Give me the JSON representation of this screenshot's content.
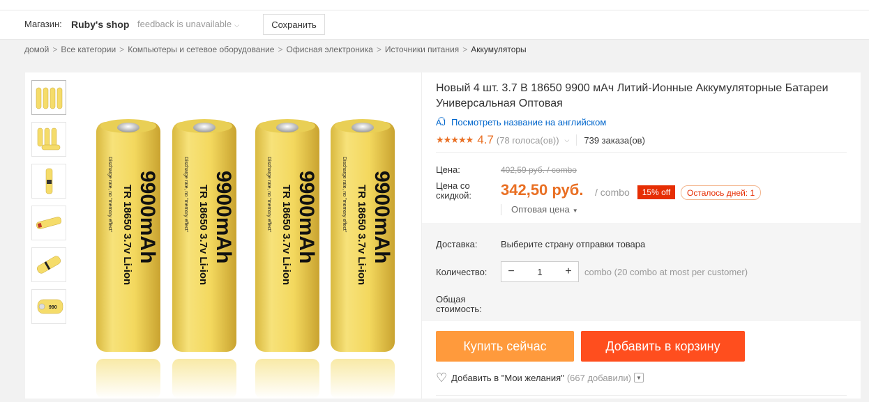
{
  "store": {
    "label": "Магазин:",
    "name": "Ruby's shop",
    "feedback": "feedback is unavailable",
    "save_label": "Сохранить"
  },
  "breadcrumb": {
    "items": [
      "домой",
      "Все категории",
      "Компьютеры и сетевое оборудование",
      "Офисная электроника",
      "Источники питания"
    ],
    "current": "Аккумуляторы",
    "separator": ">"
  },
  "product": {
    "title": "Новый 4 шт. 3.7 В 18650 9900 мАч Литий-Ионные Аккумуляторные Батареи Универсальная Оптовая",
    "translate_label": "Посмотреть название на английском",
    "rating": "4.7",
    "rating_value": 4.7,
    "votes": "(78 голоса(ов))",
    "orders": "739 заказа(ов)",
    "battery_label_1": "9900mAh",
    "battery_label_2": "TR 18650 3.7v Li-ion",
    "battery_label_3": "Discharge rate, no \"memory effect\""
  },
  "pricing": {
    "price_label": "Цена:",
    "old_price": "402,59 руб. / combo",
    "discount_label": "Цена со скидкой:",
    "new_price": "342,50 руб.",
    "per_unit": "/ combo",
    "off_badge": "15% off",
    "days_left": "Осталось дней: 1",
    "wholesale": "Оптовая цена"
  },
  "purchase": {
    "shipping_label": "Доставка:",
    "shipping_value": "Выберите страну отправки товара",
    "quantity_label": "Количество:",
    "quantity_value": "1",
    "quantity_note": "combo (20 combo at most per customer)",
    "total_label": "Общая стоимость:",
    "buy_now": "Купить сейчас",
    "add_to_cart": "Добавить в корзину",
    "wishlist": "Добавить в \"Мои желания\"",
    "wishlist_count": "(667 добавили)"
  },
  "colors": {
    "accent": "#e96f23",
    "buy_now": "#ff9a3c",
    "add_to_cart": "#ff4e1e",
    "badge": "#e62e04",
    "link": "#0066cc",
    "battery": "#f5dc6a"
  },
  "icons": {
    "translate": "translate-icon",
    "heart": "heart-icon",
    "chevron": "chevron-down-icon",
    "minus": "minus-icon",
    "plus": "plus-icon"
  }
}
